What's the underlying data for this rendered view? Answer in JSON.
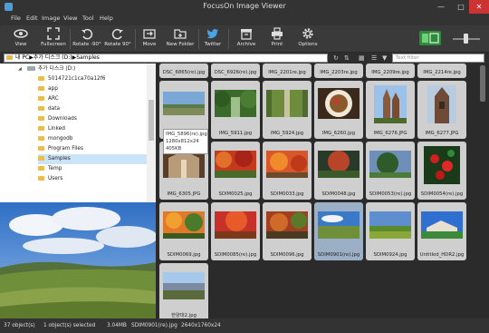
{
  "window": {
    "title": "FocusOn Image Viewer"
  },
  "menu": [
    "File",
    "Edit",
    "Image",
    "View",
    "Tool",
    "Help"
  ],
  "toolbar": [
    {
      "label": "View",
      "icon": "eye-icon"
    },
    {
      "label": "Fullscreen",
      "icon": "fullscreen-icon"
    },
    {
      "label": "Rotate -90°",
      "icon": "rotate-left-icon"
    },
    {
      "label": "Rotate 90°",
      "icon": "rotate-right-icon"
    },
    {
      "label": "Move",
      "icon": "move-icon"
    },
    {
      "label": "New Folder",
      "icon": "new-folder-icon"
    },
    {
      "label": "Twitter",
      "icon": "twitter-icon"
    },
    {
      "label": "Archive",
      "icon": "archive-icon"
    },
    {
      "label": "Print",
      "icon": "print-icon"
    },
    {
      "label": "Options",
      "icon": "gear-icon"
    }
  ],
  "address": {
    "path": "내 PC▶추가 디스크 (D:)▶Samples"
  },
  "filter": {
    "placeholder": "Text filter"
  },
  "tree": {
    "drive": "추가 디스크 (D:)",
    "items": [
      {
        "label": "5014721c1ca70a12f6"
      },
      {
        "label": "app"
      },
      {
        "label": "ARC"
      },
      {
        "label": "data"
      },
      {
        "label": "Downloads"
      },
      {
        "label": "Linked"
      },
      {
        "label": "mongodb"
      },
      {
        "label": "Program Files"
      },
      {
        "label": "Samples",
        "selected": true
      },
      {
        "label": "Temp"
      },
      {
        "label": "Users"
      }
    ]
  },
  "tooltip": {
    "name": "IMG_5896(re).jpg",
    "dims": "1280x812x24",
    "size": "405KB"
  },
  "thumbnails": [
    {
      "name": "DSC_6865(re).jpg"
    },
    {
      "name": "DSC_6926(re).jpg"
    },
    {
      "name": "IMG_2201re.jpg"
    },
    {
      "name": "IMG_2203re.jpg"
    },
    {
      "name": "IMG_2209re.jpg"
    },
    {
      "name": "IMG_2214re.jpg"
    },
    {
      "name": "IMG_5896(re).jpg"
    },
    {
      "name": "IMG_5911.jpg"
    },
    {
      "name": "IMG_5924.jpg"
    },
    {
      "name": "IMG_6260.jpg"
    },
    {
      "name": "IMG_6276.JPG"
    },
    {
      "name": "IMG_6277.JPG"
    },
    {
      "name": "IMG_6305.JPG"
    },
    {
      "name": "SDIM0025.jpg"
    },
    {
      "name": "SDIM0033.jpg"
    },
    {
      "name": "SDIM0048.jpg"
    },
    {
      "name": "SDIM0053(re).jpg"
    },
    {
      "name": "SDIM0054(re).jpg"
    },
    {
      "name": "SDIM0069.jpg"
    },
    {
      "name": "SDIM0085(re).jpg"
    },
    {
      "name": "SDIM0096.jpg"
    },
    {
      "name": "SDIM0901(re).jpg",
      "selected": true
    },
    {
      "name": "SDIM0924.jpg"
    },
    {
      "name": "Untitled_HDR2.jpg"
    },
    {
      "name": "한양대2.jpg"
    }
  ],
  "status": {
    "count": "37 object(s)",
    "selected": "1 object(s) selected",
    "size": "3.04MB",
    "file": "SDIM0901(re).jpg",
    "dims": "2640x1760x24"
  },
  "colors": {
    "selection": "#cce4f7",
    "folder": "#e9bd52",
    "close": "#cc3333"
  }
}
